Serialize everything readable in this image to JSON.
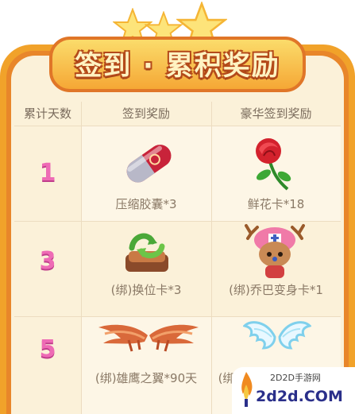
{
  "title": "签到 · 累积奖励",
  "columns": {
    "days": "累计天数",
    "reward": "签到奖励",
    "deluxe": "豪华签到奖励"
  },
  "rows": [
    {
      "day": "1",
      "reward": "压缩胶囊*3",
      "reward_icon": "capsule-icon",
      "deluxe": "鲜花卡*18",
      "deluxe_icon": "rose-icon"
    },
    {
      "day": "3",
      "reward": "(绑)换位卡*3",
      "reward_icon": "swap-card-icon",
      "deluxe": "(绑)乔巴变身卡*1",
      "deluxe_icon": "chopper-icon"
    },
    {
      "day": "5",
      "reward": "(绑)雄鹰之翼*90天",
      "reward_icon": "eagle-wings-icon",
      "deluxe": "(绑",
      "deluxe_icon": "angel-wings-icon"
    }
  ],
  "watermark": {
    "site": "2D2D手游网",
    "domain": "2d2d.COM"
  },
  "colors": {
    "frame": "#e8862a",
    "cream": "#fbf1d9",
    "day_number": "#ee6bb5"
  }
}
